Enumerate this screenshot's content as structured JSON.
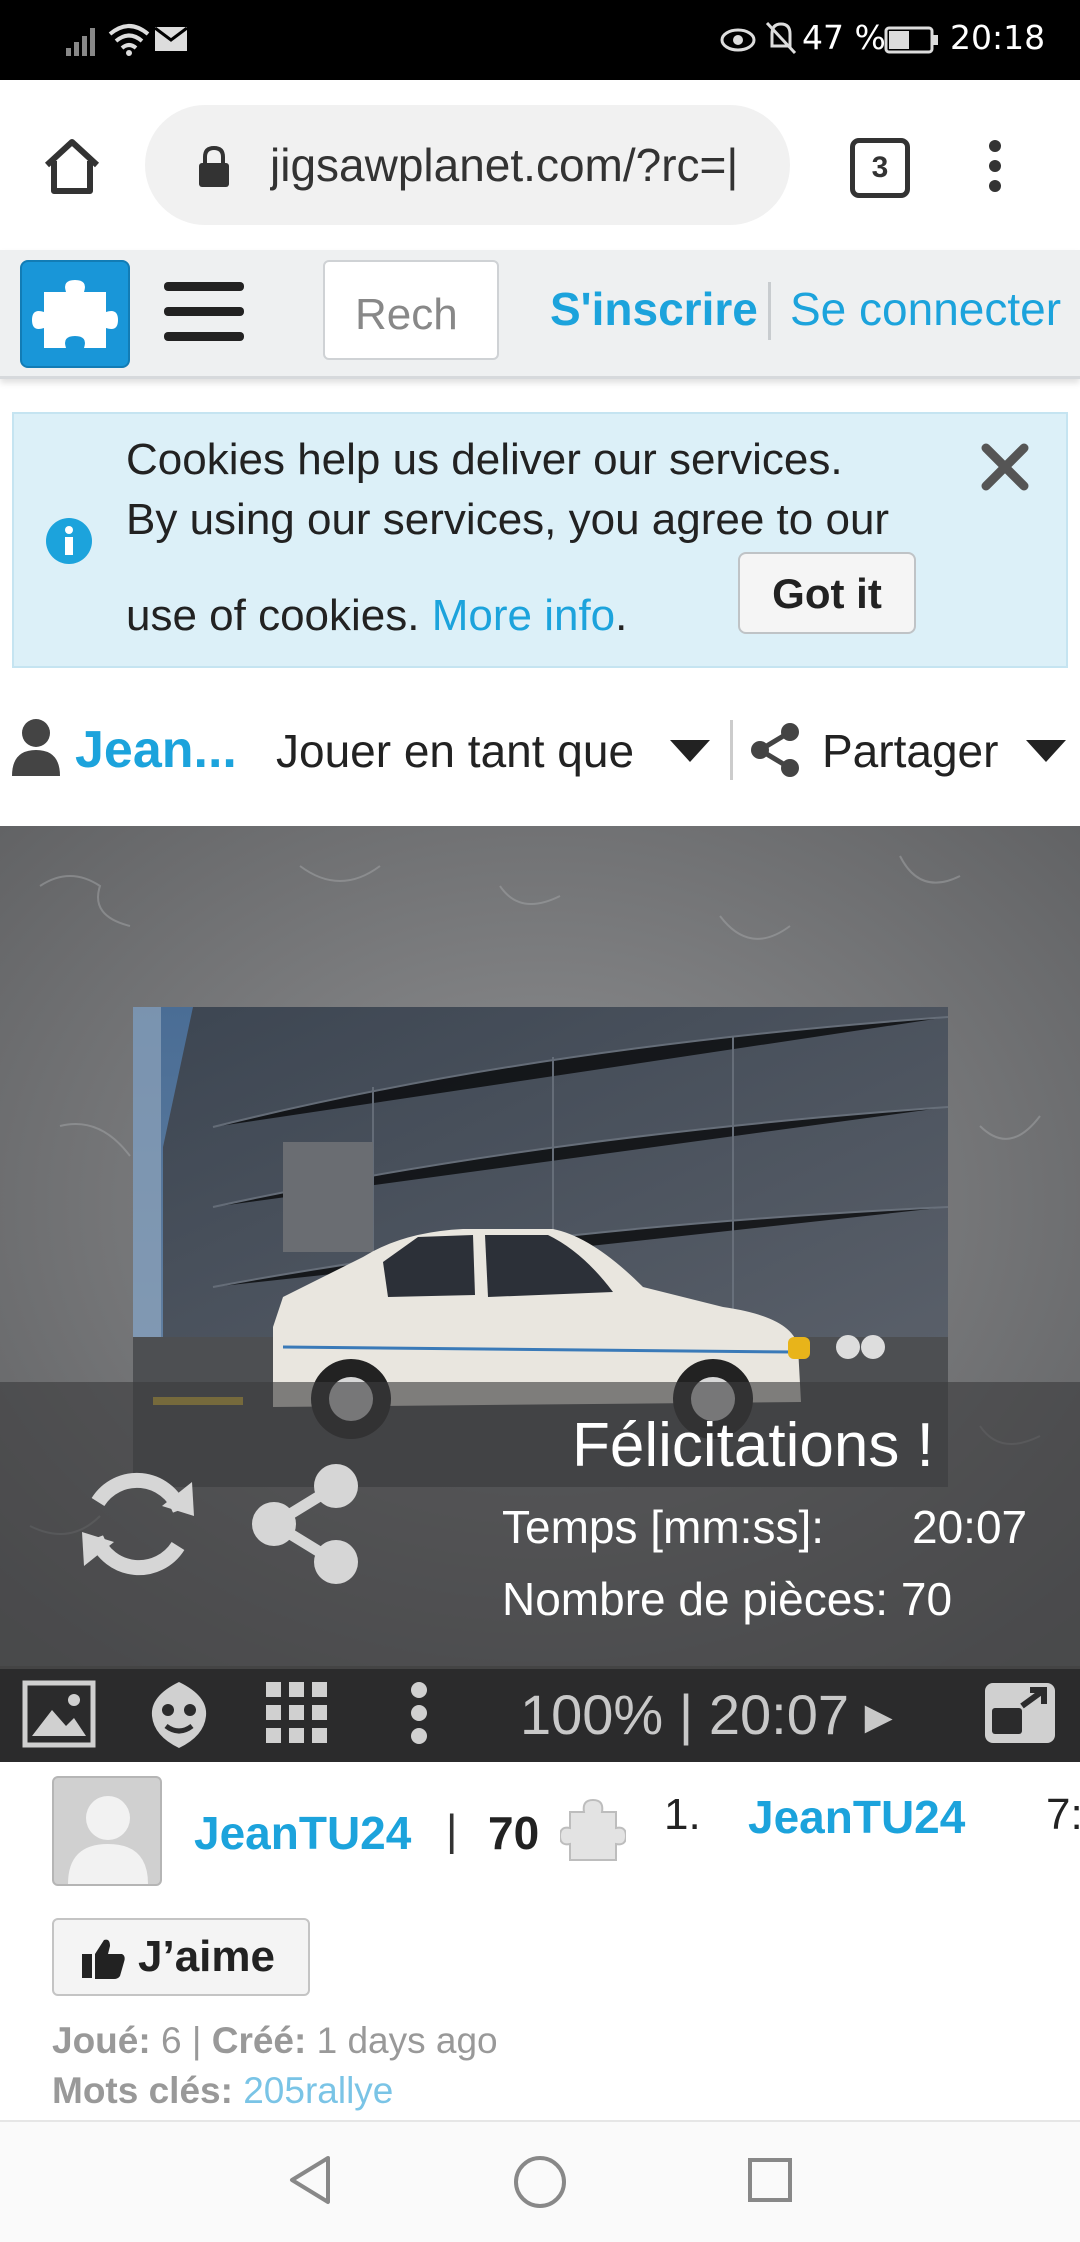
{
  "status_bar": {
    "battery_percent": "47 %",
    "time": "20:18"
  },
  "browser": {
    "url": "jigsawplanet.com/?rc=|",
    "tab_count": "3"
  },
  "site_header": {
    "search_placeholder": "Rech",
    "signup": "S'inscrire",
    "login": "Se connecter"
  },
  "cookie_banner": {
    "line1": "Cookies help us deliver our services.",
    "line2": "By using our services, you agree to our",
    "line3": "use of cookies.",
    "more_info": "More info",
    "period": ".",
    "got_it": "Got it"
  },
  "user_row": {
    "user": "Jean...",
    "play_as": "Jouer en tant que",
    "share": "Partager"
  },
  "completion": {
    "title": "Félicitations !",
    "time_label": "Temps [mm:ss]:",
    "time_value": "20:07",
    "pieces_label": "Nombre de pièces: 70"
  },
  "toolbar": {
    "zoom_time": "100% | 20:07 ▸"
  },
  "puzzle_info": {
    "author": "JeanTU24",
    "separator": "|",
    "pieces": "70",
    "rank": "1.",
    "rank_name": "JeanTU24",
    "rank_value": "7:",
    "like": "J’aime",
    "played_label": "Joué:",
    "played_value": " 6 | ",
    "created_label": "Créé:",
    "created_value": " 1 days ago",
    "keywords_label": "Mots clés:",
    "keywords_value": " 205rallye"
  },
  "colors": {
    "accent": "#1ca3dc",
    "cookie_bg": "#dcf0f8",
    "toolbar_bg": "#2b2b2c"
  }
}
